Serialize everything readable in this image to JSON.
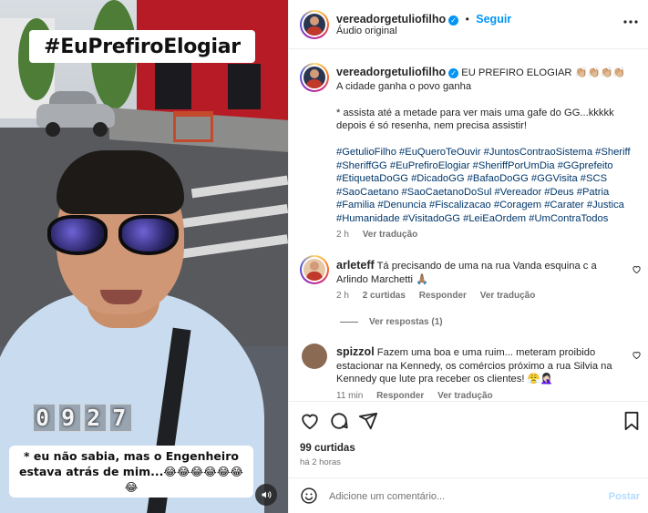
{
  "video": {
    "hashtag_banner": "#EuPrefiroElogiar",
    "timer_digits": [
      "0",
      "9",
      "2",
      "7"
    ],
    "caption": "* eu não sabia, mas o Engenheiro estava atrás de mim...😂😂😂😂😂😂😂",
    "sound_icon": "speaker-icon"
  },
  "header": {
    "username": "vereadorgetuliofilho",
    "verified": true,
    "dot": "•",
    "follow_label": "Seguir",
    "audio_label": "Áudio original",
    "more_icon": "more-horizontal-icon"
  },
  "post_caption": {
    "username": "vereadorgetuliofilho",
    "title": "EU PREFIRO ELOGIAR 👏🏼👏🏼👏🏼👏🏼",
    "line2": "A cidade ganha o povo ganha",
    "line3": "* assista até a metade para ver mais uma gafe do GG...kkkkk depois é só resenha, nem precisa assistir!",
    "hashtags": "#GetulioFilho #EuQueroTeOuvir #JuntosContraoSistema #Sheriff #SheriffGG #EuPrefiroElogiar #SheriffPorUmDia #GGprefeito #EtiquetaDoGG #DicadoGG #BafaoDoGG #GGVisita #SCS #SaoCaetano #SaoCaetanoDoSul #Vereador #Deus #Patria #Familia #Denuncia #Fiscalizacao #Coragem #Carater #Justica #Humanidade #VisitadoGG #LeiEaOrdem #UmContraTodos",
    "time": "2 h",
    "translate": "Ver tradução"
  },
  "comments": [
    {
      "username": "arleteff",
      "text": "Tá precisando de uma na rua Vanda esquina c a Arlindo Marchetti 🙏🏽",
      "time": "2 h",
      "likes": "2 curtidas",
      "reply": "Responder",
      "translate": "Ver tradução",
      "view_replies": "Ver respostas (1)"
    },
    {
      "username": "spizzol",
      "text": "Fazem uma boa e uma ruim... meteram proibido estacionar na Kennedy, os comércios próximo a rua Silvia na Kennedy que lute pra receber os clientes! 😤🤦🏻‍♀️",
      "time": "11 min",
      "reply": "Responder",
      "translate": "Ver tradução"
    }
  ],
  "actions": {
    "like_icon": "heart-icon",
    "comment_icon": "comment-icon",
    "share_icon": "share-icon",
    "save_icon": "bookmark-icon",
    "likes_count": "99 curtidas",
    "posted": "há 2 horas"
  },
  "add_comment": {
    "emoji_icon": "emoji-icon",
    "placeholder": "Adicione um comentário...",
    "post_label": "Postar"
  },
  "colors": {
    "accent": "#0095f6",
    "hashtag": "#00376b",
    "muted": "#737373"
  }
}
